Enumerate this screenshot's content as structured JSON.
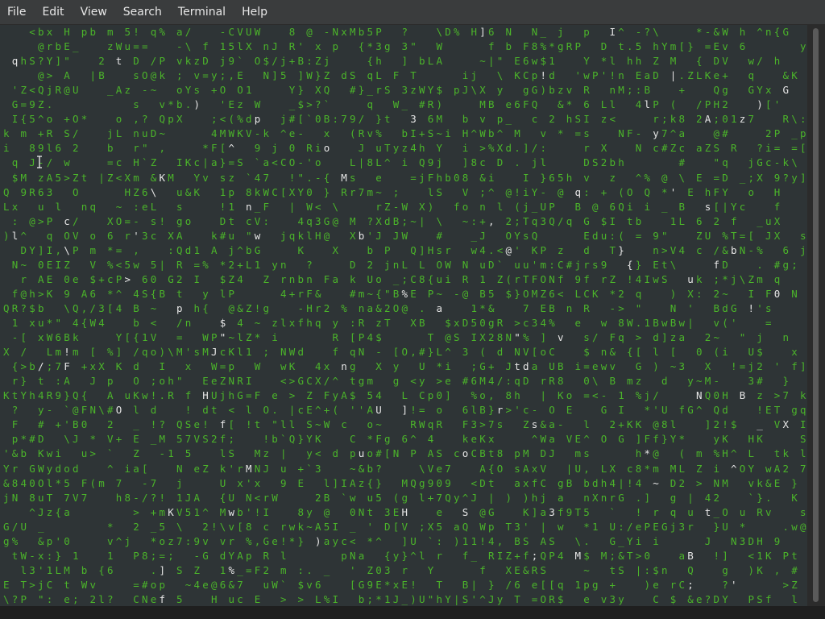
{
  "menubar": {
    "items": [
      {
        "label": "File"
      },
      {
        "label": "Edit"
      },
      {
        "label": "View"
      },
      {
        "label": "Search"
      },
      {
        "label": "Terminal"
      },
      {
        "label": "Help"
      }
    ]
  },
  "terminal": {
    "background": "#2e3436",
    "green": "#4bb42a",
    "white": "#e6e6e6",
    "charset": "0123456789ABCDEFGHIJKLMNOPQRSTUVWXYZabcdefghijklmnopqrstuvwxyz!\"#$%&'()*+,-./:;<=>?@[\\]^_`{|}~"
  }
}
